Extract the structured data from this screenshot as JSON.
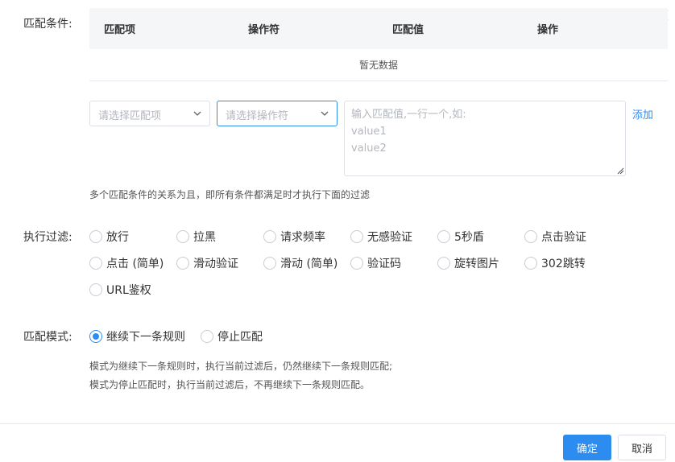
{
  "match_conditions": {
    "label": "匹配条件:",
    "table": {
      "columns": [
        "匹配项",
        "操作符",
        "匹配值",
        "操作"
      ],
      "empty_text": "暂无数据"
    },
    "match_item_select": {
      "placeholder": "请选择匹配项"
    },
    "operator_select": {
      "placeholder": "请选择操作符"
    },
    "value_textarea": {
      "placeholder": "输入匹配值,一行一个,如:\nvalue1\nvalue2",
      "value": ""
    },
    "add_label": "添加",
    "hint": "多个匹配条件的关系为且，即所有条件都满足时才执行下面的过滤"
  },
  "filter_action": {
    "label": "执行过滤:",
    "options": [
      "放行",
      "拉黑",
      "请求频率",
      "无感验证",
      "5秒盾",
      "点击验证",
      "点击 (简单)",
      "滑动验证",
      "滑动 (简单)",
      "验证码",
      "旋转图片",
      "302跳转",
      "URL鉴权"
    ],
    "selected": null
  },
  "match_mode": {
    "label": "匹配模式:",
    "options": [
      "继续下一条规则",
      "停止匹配"
    ],
    "selected": "继续下一条规则",
    "hint_lines": [
      "模式为继续下一条规则时，执行当前过滤后，仍然继续下一条规则匹配;",
      "模式为停止匹配时，执行当前过滤后，不再继续下一条规则匹配。"
    ]
  },
  "footer": {
    "confirm_label": "确定",
    "cancel_label": "取消"
  },
  "colors": {
    "accent": "#2d8cf0",
    "header_bg": "#f5f6f8",
    "border": "#dcdfe6"
  },
  "icons": {
    "close": "close-icon",
    "dropdown": "chevron-down-icon"
  }
}
